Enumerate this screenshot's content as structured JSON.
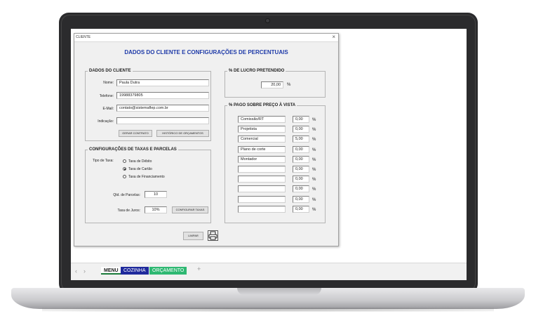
{
  "window": {
    "title": "CLIENTE",
    "close": "×"
  },
  "heading": "DADOS DO CLIENTE E CONFIGURAÇÕES DE PERCENTUAIS",
  "cliente": {
    "legend": "DADOS DO CLIENTE",
    "nome_label": "Nome:",
    "nome_value": "Paula Dutra",
    "telefone_label": "Telefone:",
    "telefone_value": "19988379805",
    "email_label": "E-Mail:",
    "email_value": "contato@sistemaflep.com.br",
    "indicacao_label": "Indicação:",
    "indicacao_value": "",
    "gerar_contrato": "GERAR CONTRATO",
    "historico": "HISTÓRICO DE ORÇAMENTOS"
  },
  "taxas": {
    "legend": "CONFIGURAÇÕES DE TAXAS E PARCELAS",
    "tipo_label": "Tipo de Taxa:",
    "options": [
      "Taxa de Débito",
      "Taxa de Cartão",
      "Taxa de Financiamento"
    ],
    "selected": "Taxa de Cartão",
    "parcelas_label": "Qtd. de Parcelas:",
    "parcelas_value": "10",
    "juros_label": "Taxa de Juros:",
    "juros_value": "10%",
    "configurar": "CONFIGURAR TAXAS"
  },
  "lucro": {
    "legend": "% DE LUCRO PRETENDIDO",
    "value": "20,00",
    "unit": "%"
  },
  "pago": {
    "legend": "% PAGO SOBRE PREÇO À VISTA",
    "unit": "%",
    "rows": [
      {
        "name": "Comissão/RT",
        "value": "0,00"
      },
      {
        "name": "Projetista",
        "value": "0,00"
      },
      {
        "name": "Comercial",
        "value": "5,00"
      },
      {
        "name": "Plano de corte",
        "value": "0,00"
      },
      {
        "name": "Montador",
        "value": "0,00"
      },
      {
        "name": "",
        "value": "0,00"
      },
      {
        "name": "",
        "value": "0,00"
      },
      {
        "name": "",
        "value": "0,00"
      },
      {
        "name": "",
        "value": "0,00"
      },
      {
        "name": "",
        "value": "0,00"
      }
    ]
  },
  "limpar": "LIMPAR",
  "sheets": {
    "nav_prev": "‹",
    "nav_next": "›",
    "menu": "MENU",
    "cozinha": "COZINHA",
    "orcamento": "ORÇAMENTO",
    "add": "+"
  }
}
